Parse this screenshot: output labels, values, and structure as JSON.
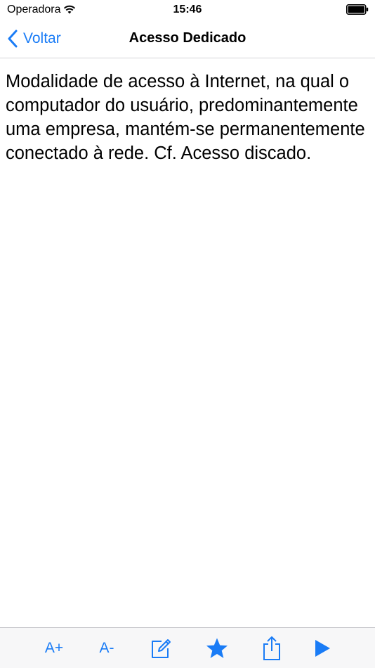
{
  "status_bar": {
    "carrier": "Operadora",
    "time": "15:46"
  },
  "nav": {
    "back_label": "Voltar",
    "title": "Acesso Dedicado"
  },
  "content": {
    "definition": "Modalidade de acesso à Internet, na qual o computador do usuário, predominantemente uma empresa, mantém-se permanentemente conectado à rede. Cf. Acesso discado."
  },
  "toolbar": {
    "increase_font_label": "A+",
    "decrease_font_label": "A-",
    "icons": [
      "edit-note-icon",
      "star-icon",
      "share-icon",
      "play-icon"
    ]
  },
  "colors": {
    "accent": "#1a7cf6",
    "toolbar_bg": "#f7f7f8",
    "separator": "#d3d3d6"
  }
}
